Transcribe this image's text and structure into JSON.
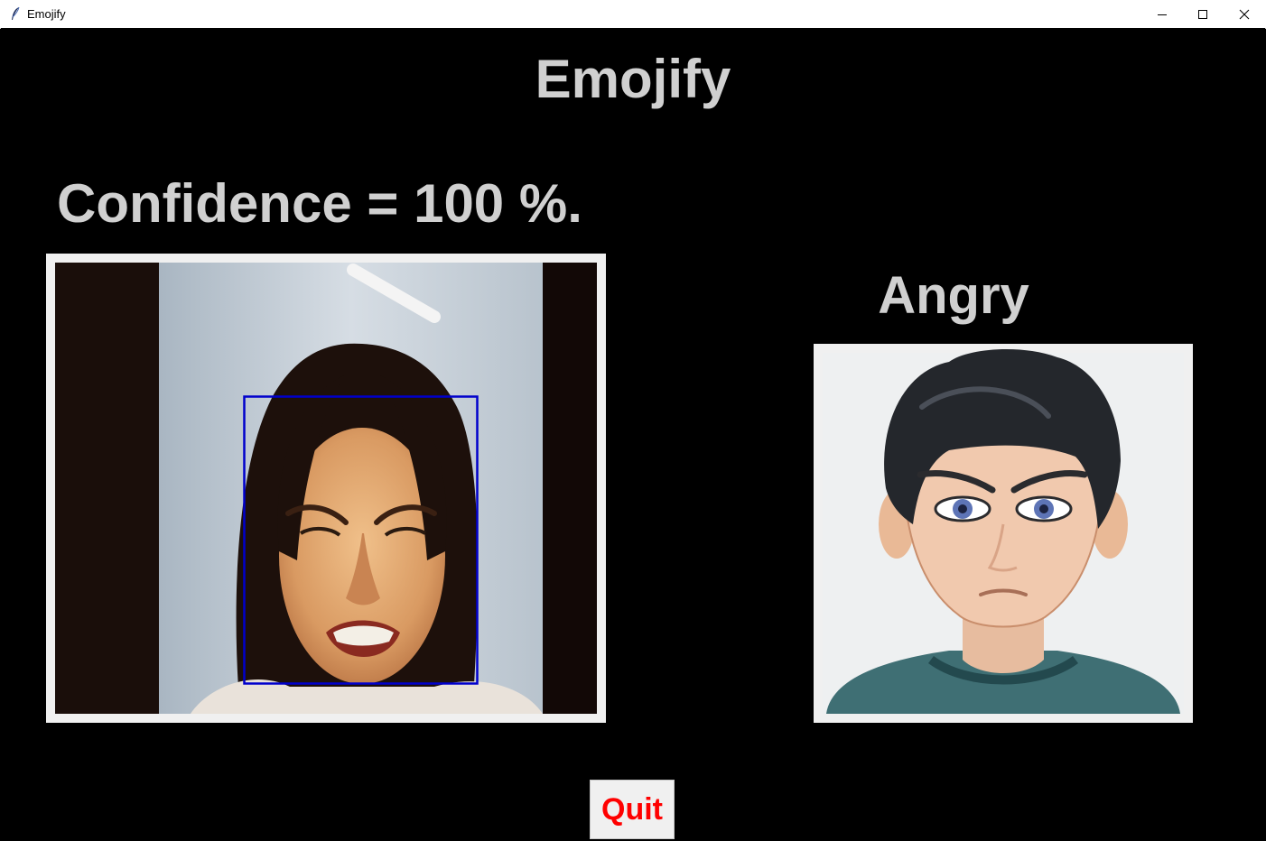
{
  "window": {
    "title": "Emojify",
    "icon": "feather-icon",
    "controls": [
      "minimize-icon",
      "maximize-icon",
      "close-icon"
    ]
  },
  "app": {
    "title": "Emojify",
    "confidence_text": "Confidence = 100 %.",
    "emotion_label": "Angry",
    "quit_label": "Quit"
  },
  "colors": {
    "background": "#000000",
    "text": "#d0d0d0",
    "quit_text": "#ff0000",
    "face_box": "#0000cc",
    "frame": "#f0f0f0"
  }
}
